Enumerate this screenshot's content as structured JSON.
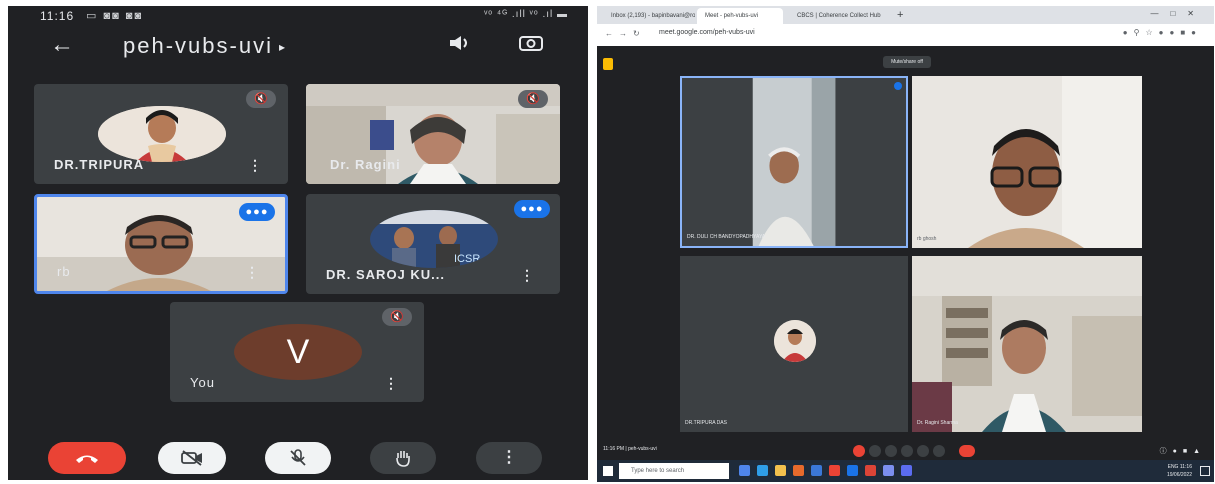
{
  "phone": {
    "status": {
      "time": "11:16",
      "notifications": "▭ ◙◙ ◙◙",
      "network": "ᵛᵒ ⁴ᴳ .ıll ᵛᵒ .ıl ▬"
    },
    "topbar": {
      "back_icon": "arrow-left-icon",
      "meeting_code": "peh-vubs-uvi",
      "caret": "▸",
      "speaker_icon": "speaker-icon",
      "camera_flip_icon": "camera-flip-icon"
    },
    "participants": [
      {
        "name": "DR.TRIPURA",
        "muted": true
      },
      {
        "name": "Dr. Ragini",
        "muted": true
      },
      {
        "name": "rb",
        "speaking": true
      },
      {
        "name": "DR. SAROJ KU...",
        "speaking": true
      },
      {
        "name": "You",
        "avatar_letter": "V",
        "muted": true
      }
    ],
    "controls": {
      "end_call_icon": "end-call-icon",
      "camera_off_icon": "camera-off-icon",
      "mic_off_icon": "mic-off-icon",
      "raise_hand_icon": "raise-hand-icon",
      "more_icon": "more-vert-icon"
    },
    "colors": {
      "end_call": "#ea4335",
      "active_speaker_border": "#4f86ec",
      "you_avatar": "#6d3d2c"
    }
  },
  "desktop": {
    "tabs": [
      "Inbox (2,193) - bapinbavani@ro",
      "Meet - peh-vubs-uvi",
      "CBCS | Coherence Collect Hub"
    ],
    "url": "meet.google.com/peh-vubs-uvi",
    "mute_notice": "Mute/share off",
    "tiles": [
      {
        "name": "DR. DULI CH BANDYOPADHYAYA"
      },
      {
        "name": "rb ghosh"
      },
      {
        "name": "DR.TRIPURA DAS"
      },
      {
        "name": "Dr. Ragini Sharma"
      }
    ],
    "bottom_bar": {
      "time": "11:16 PM",
      "code": "peh-vubs-uvi"
    },
    "taskbar": {
      "search_placeholder": "Type here to search",
      "tray_time": "11:16",
      "tray_date": "19/06/2022",
      "tray_lang": "ENG"
    }
  }
}
